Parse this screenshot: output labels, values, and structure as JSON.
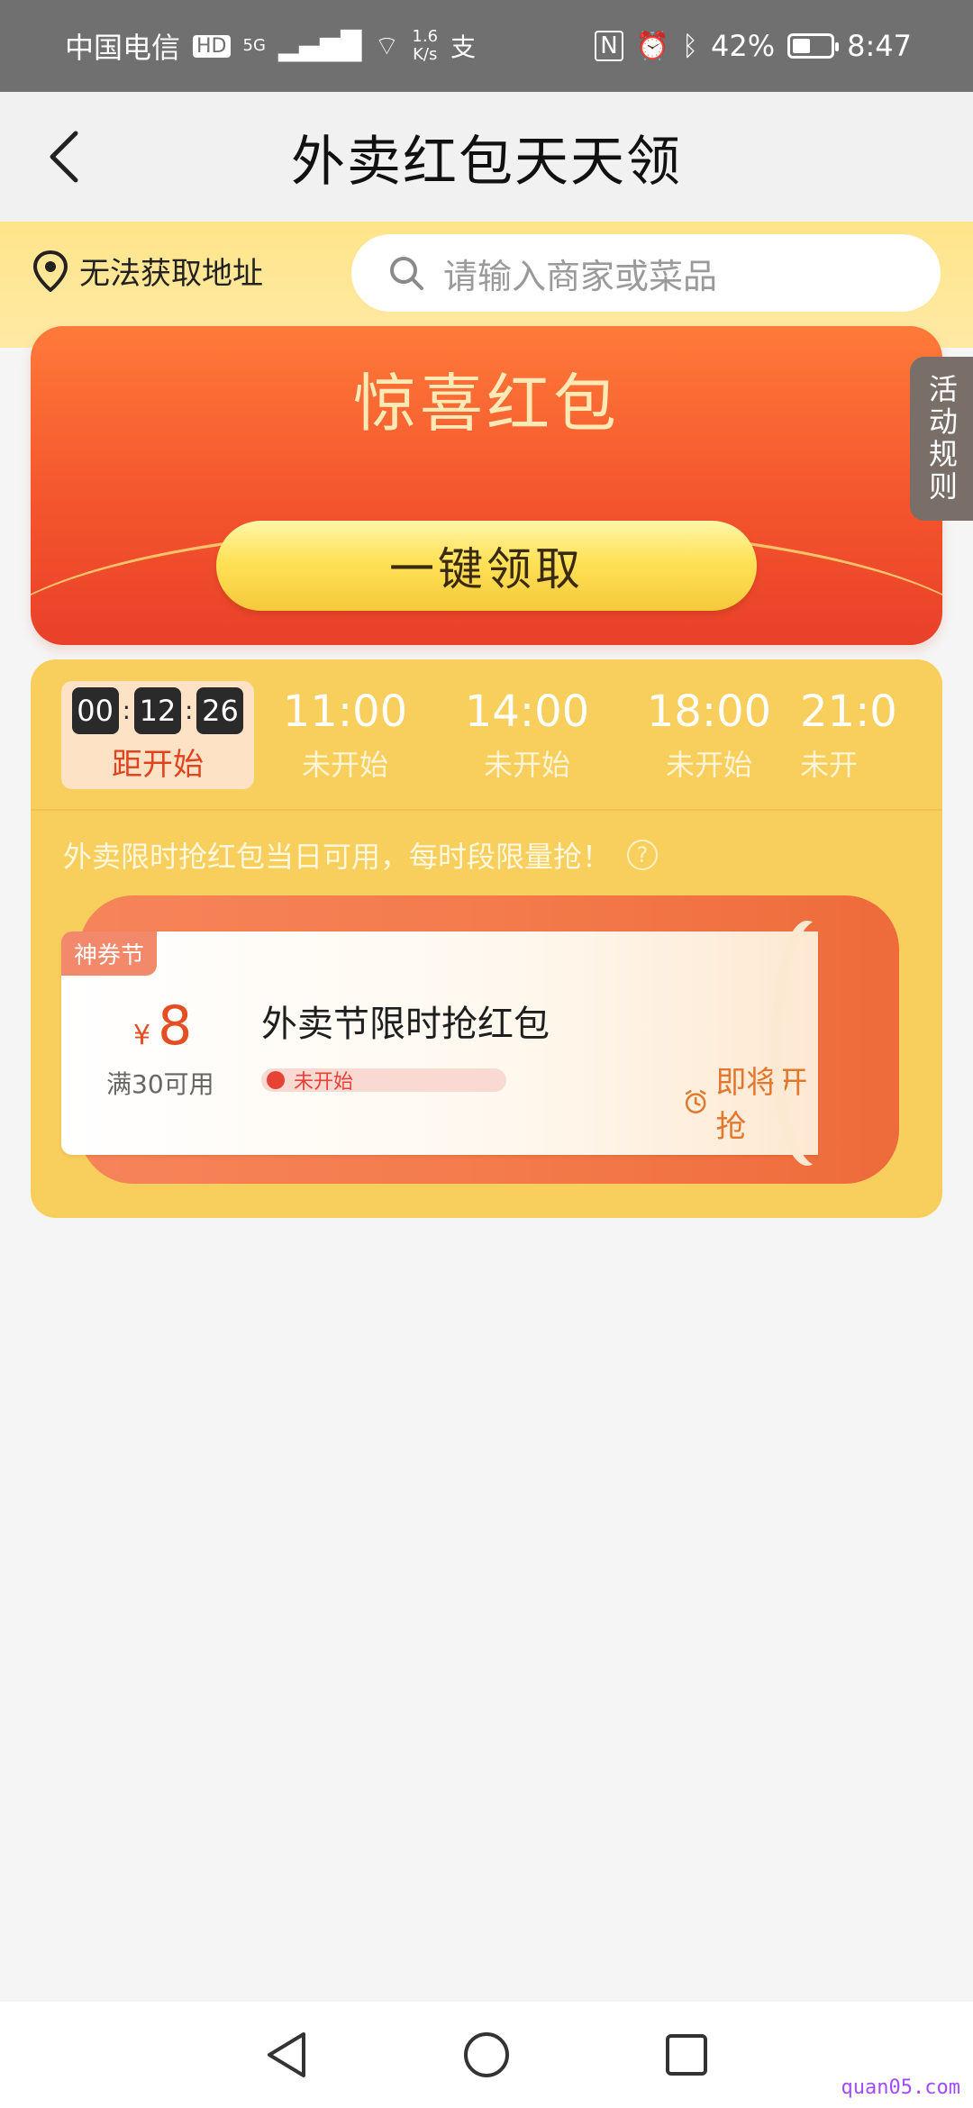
{
  "status_bar": {
    "carrier": "中国电信",
    "hd": "HD",
    "net_type": "5G",
    "wifi": "6",
    "speed": "1.6",
    "speed_unit": "K/s",
    "extra_icon": "支",
    "battery": "42%",
    "time": "8:47",
    "icons": [
      "nfc-icon",
      "alarm-icon",
      "bluetooth-icon",
      "battery-icon"
    ]
  },
  "nav": {
    "title": "外卖红包天天领",
    "back_icon": "chevron-left-icon"
  },
  "location": {
    "text": "无法获取地址",
    "icon": "location-pin-icon"
  },
  "search": {
    "placeholder": "请输入商家或菜品",
    "icon": "search-icon"
  },
  "surprise": {
    "title": "惊喜红包",
    "claim_button": "一键领取"
  },
  "rules_tab": "活动规则",
  "timeline": {
    "countdown": {
      "h": "00",
      "m": "12",
      "s": "26"
    },
    "active_label": "距开始",
    "slots": [
      {
        "time": "11:00",
        "status": "未开始"
      },
      {
        "time": "14:00",
        "status": "未开始"
      },
      {
        "time": "18:00",
        "status": "未开始"
      },
      {
        "time": "21:0",
        "status": "未开"
      }
    ],
    "notice": "外卖限时抢红包当日可用，每时段限量抢！"
  },
  "coupon": {
    "badge": "神券节",
    "currency": "¥",
    "amount": "8",
    "condition": "满30可用",
    "title": "外卖节限时抢红包",
    "progress_label": "未开始",
    "action": "即将开抢"
  },
  "watermark": "quan05.com",
  "colors": {
    "accent_red": "#e54d23",
    "panel_yellow": "#f8cf5c",
    "button_yellow": "#ffe257"
  }
}
